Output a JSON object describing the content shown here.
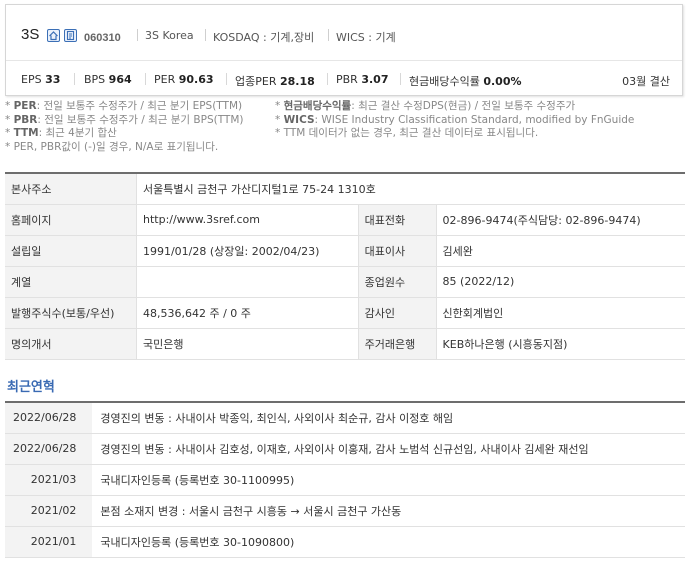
{
  "header": {
    "company_name": "3S",
    "code": "060310",
    "country": "3S Korea",
    "market": "KOSDAQ : 기계,장비",
    "wics": "WICS : 기계",
    "icons": [
      "home-icon",
      "report-icon"
    ]
  },
  "metrics": [
    {
      "label": "EPS",
      "value": "33"
    },
    {
      "label": "BPS",
      "value": "964"
    },
    {
      "label": "PER",
      "value": "90.63"
    },
    {
      "label": "업종PER",
      "value": "28.18"
    },
    {
      "label": "PBR",
      "value": "3.07"
    },
    {
      "label": "현금배당수익률",
      "value": "0.00%"
    }
  ],
  "settlement": "03월 결산",
  "notes": {
    "left": [
      {
        "key": "PER",
        "text": ": 전일 보통주 수정주가 / 최근 분기 EPS(TTM)"
      },
      {
        "key": "PBR",
        "text": ": 전일 보통주 수정주가 / 최근 분기 BPS(TTM)"
      },
      {
        "key": "TTM",
        "text": ": 최근 4분기 합산"
      },
      {
        "key": "",
        "text": "PER, PBR값이 (-)일 경우, N/A로 표기됩니다."
      }
    ],
    "right": [
      {
        "key": "현금배당수익률",
        "text": ": 최근 결산 수정DPS(현금) / 전일 보통주 수정주가"
      },
      {
        "key": "WICS",
        "text": ": WISE Industry Classification Standard, modified by FnGuide"
      },
      {
        "key": "",
        "text": "TTM 데이터가 없는 경우, 최근 결산 데이터로 표시됩니다."
      }
    ]
  },
  "info": {
    "address_label": "본사주소",
    "address": "서울특별시 금천구 가산디지털1로 75-24 1310호",
    "homepage_label": "홈페이지",
    "homepage": "http://www.3sref.com",
    "phone_label": "대표전화",
    "phone": "02-896-9474(주식담당: 02-896-9474)",
    "founded_label": "설립일",
    "founded": "1991/01/28 (상장일: 2002/04/23)",
    "ceo_label": "대표이사",
    "ceo": "김세완",
    "group_label": "계열",
    "group": "",
    "employees_label": "종업원수",
    "employees": "85 (2022/12)",
    "shares_label": "발행주식수(보통/우선)",
    "shares": "48,536,642 주 / 0 주",
    "auditor_label": "감사인",
    "auditor": "신한회계법인",
    "transfer_label": "명의개서",
    "transfer": "국민은행",
    "bank_label": "주거래은행",
    "bank": "KEB하나은행 (시흥동지점)"
  },
  "history_title": "최근연혁",
  "history": [
    {
      "date": "2022/06/28",
      "text": "경영진의 변동 : 사내이사 박종익, 최인식, 사외이사 최순규, 감사 이정호 해임"
    },
    {
      "date": "2022/06/28",
      "text": "경영진의 변동 : 사내이사 김호성, 이재호, 사외이사 이홍재, 감사 노범석 신규선임, 사내이사 김세완 재선임"
    },
    {
      "date": "2021/03",
      "text": "국내디자인등록 (등록번호 30-1100995)"
    },
    {
      "date": "2021/02",
      "text": "본점 소재지 변경 : 서울시 금천구 시흥동 → 서울시 금천구 가산동"
    },
    {
      "date": "2021/01",
      "text": "국내디자인등록 (등록번호 30-1090800)"
    }
  ]
}
